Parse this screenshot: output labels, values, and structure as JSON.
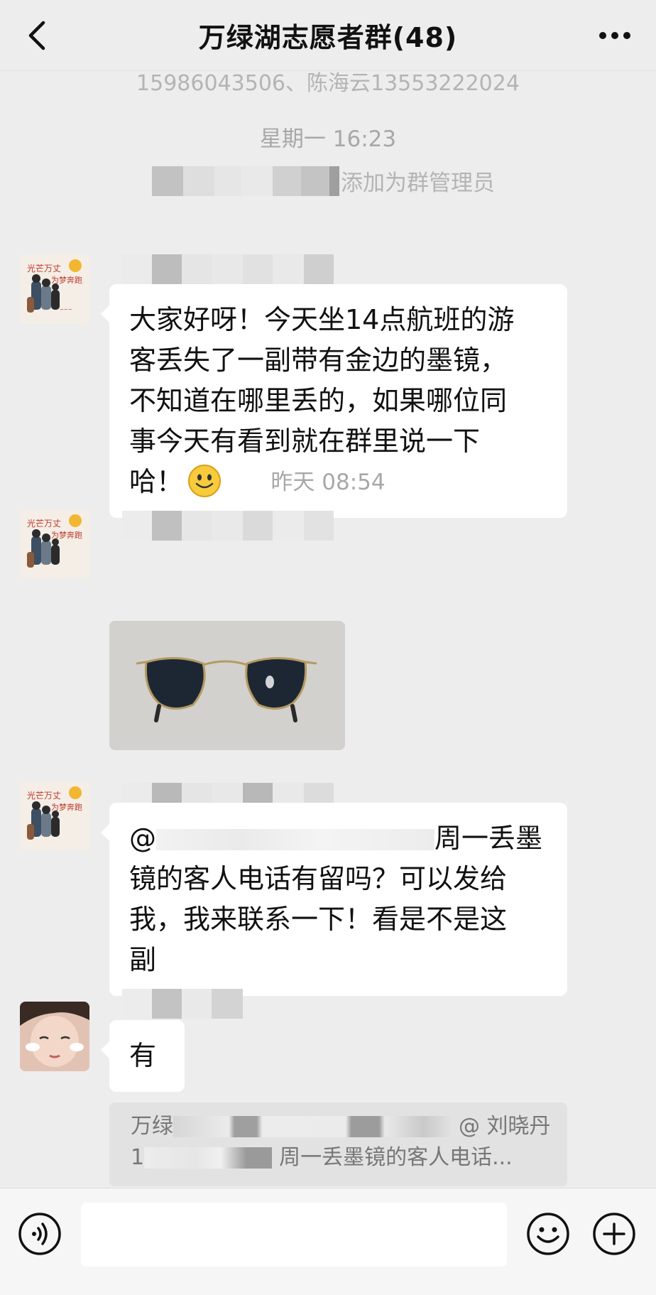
{
  "header": {
    "title": "万绿湖志愿者群(48)",
    "back_icon": "chevron-left-icon",
    "more_icon": "more-dots-icon"
  },
  "chat": {
    "top_partial": "15986043506、陈海云13553222024",
    "time1": "星期一 16:23",
    "system_admin": "添加为群管理员",
    "msg1_text_lines": [
      "大家好呀！今天坐14点航班的游",
      "客丢失了一副带有金边的墨镜，",
      "不知道在哪里丢的，如果哪位同",
      "事今天有看到就在群里说一下",
      "哈！"
    ],
    "time2": "昨天 08:54",
    "msg3_at": "@",
    "msg3_lines": [
      "周一丢墨",
      "镜的客人电话有留吗？可以发给",
      "我，我来联系一下！看是不是这",
      "副"
    ],
    "msg4_text": "有",
    "quote_line1_start": "万绿",
    "quote_line1_end": "@ 刘晓丹",
    "quote_line2_start": "1",
    "quote_line2_end": "周一丢墨镜的客人电话..."
  },
  "icons": {
    "voice": "voice-icon",
    "emoji": "emoji-icon",
    "plus": "plus-icon",
    "smiley": "smiley-emoji-icon"
  },
  "colors": {
    "background": "#ededed",
    "bubble": "#ffffff",
    "system_text": "#b4b4b4",
    "quote_bg": "#e2e2e2"
  }
}
